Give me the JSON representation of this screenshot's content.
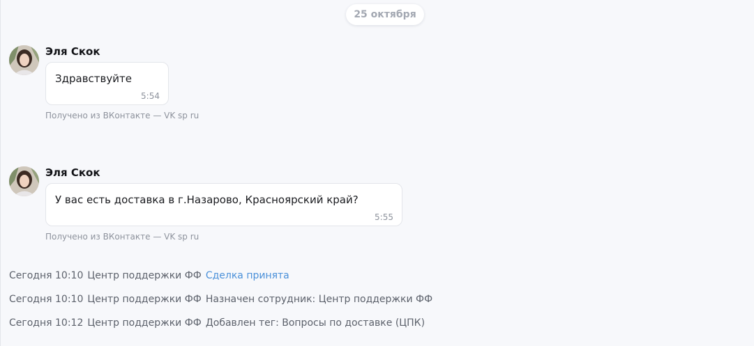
{
  "date_separator": "25 октября",
  "messages": [
    {
      "author": "Эля Скок",
      "text": "Здравствуйте",
      "time": "5:54",
      "source": "Получено из ВКонтакте — VK sp ru"
    },
    {
      "author": "Эля Скок",
      "text": "У вас есть доставка в г.Назарово, Красноярский край?",
      "time": "5:55",
      "source": "Получено из ВКонтакте — VK sp ru"
    }
  ],
  "events": [
    {
      "timestamp": "Сегодня 10:10",
      "actor": "Центр поддержки ФФ",
      "action": "Сделка принята"
    },
    {
      "timestamp": "Сегодня 10:10",
      "actor": "Центр поддержки ФФ",
      "action": "Назначен сотрудник: Центр поддержки ФФ"
    },
    {
      "timestamp": "Сегодня 10:12",
      "actor": "Центр поддержки ФФ",
      "action": "Добавлен тег: Вопросы по доставке (ЦПК)"
    }
  ],
  "colors": {
    "background": "#f7f8fb",
    "bubble": "#ffffff",
    "link": "#4a90d9",
    "muted": "#8d929c"
  }
}
